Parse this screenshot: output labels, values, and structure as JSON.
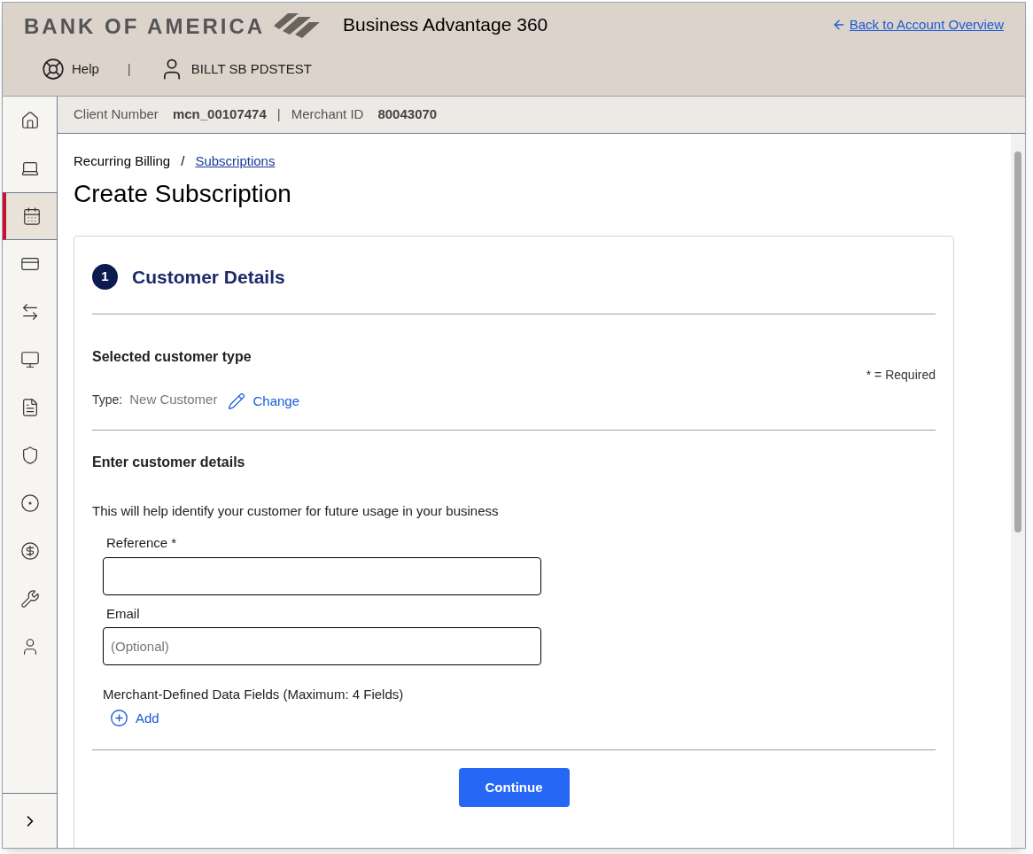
{
  "header": {
    "logo": "BANK OF AMERICA",
    "product": "Business Advantage 360",
    "back_link": "Back to Account Overview",
    "help": "Help",
    "separator": "|",
    "user": "BILLT SB PDSTEST"
  },
  "sidebar": {
    "items": [
      {
        "selected": false
      },
      {
        "selected": false
      },
      {
        "selected": true
      },
      {
        "selected": false
      },
      {
        "selected": false
      },
      {
        "selected": false
      },
      {
        "selected": false
      },
      {
        "selected": false
      },
      {
        "selected": false
      },
      {
        "selected": false
      },
      {
        "selected": false
      },
      {
        "selected": false
      }
    ]
  },
  "info_bar": {
    "client_label": "Client Number",
    "client_value": "mcn_00107474",
    "separator": "|",
    "merchant_label": "Merchant ID",
    "merchant_value": "80043070"
  },
  "breadcrumb": {
    "parent": "Recurring Billing",
    "separator": "/",
    "current": "Subscriptions"
  },
  "page_title": "Create Subscription",
  "card": {
    "step_number": "1",
    "step_title": "Customer Details",
    "customer_type": {
      "heading": "Selected customer type",
      "required_note": "* = Required",
      "type_label": "Type:",
      "type_value": "New Customer",
      "change_link": "Change"
    },
    "details": {
      "heading": "Enter customer details",
      "description": "This will help identify your customer for future usage in your business",
      "fields": [
        {
          "label": "Reference *"
        },
        {
          "label": "Email",
          "placeholder": "(Optional)"
        }
      ],
      "mdf_label": "Merchant-Defined Data Fields (Maximum: 4 Fields)",
      "add_link": "Add"
    },
    "continue_button": "Continue"
  }
}
